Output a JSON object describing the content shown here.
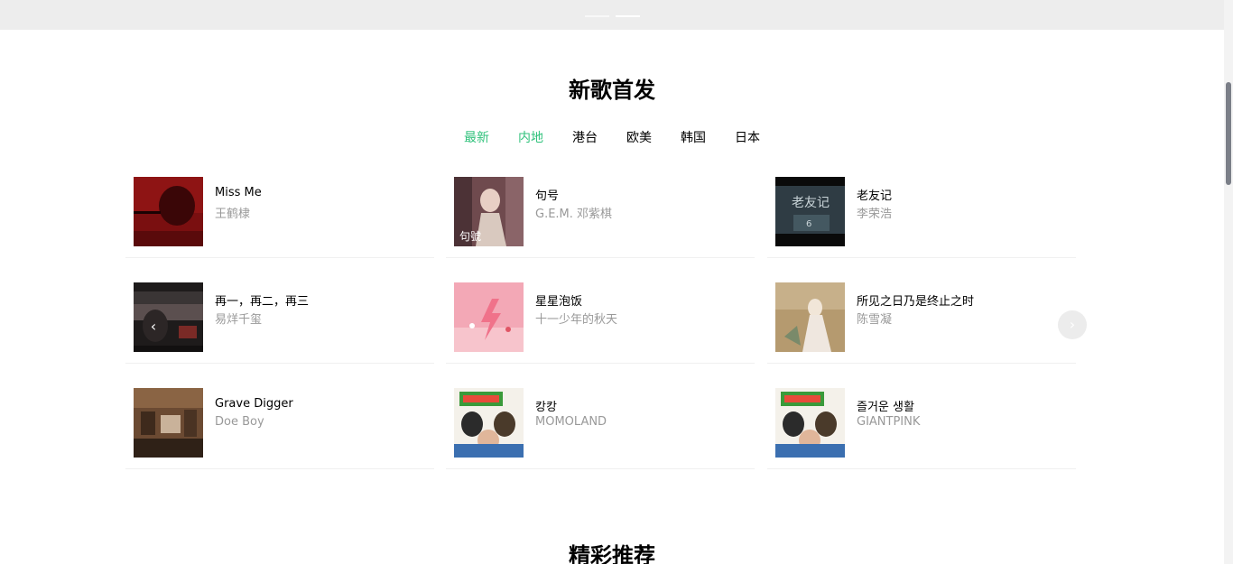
{
  "sections": {
    "new_songs_title": "新歌首发",
    "recommend_title": "精彩推荐"
  },
  "tabs": [
    {
      "label": "最新",
      "state": "active"
    },
    {
      "label": "内地",
      "state": "hover"
    },
    {
      "label": "港台",
      "state": "normal"
    },
    {
      "label": "欧美",
      "state": "normal"
    },
    {
      "label": "韩国",
      "state": "normal"
    },
    {
      "label": "日本",
      "state": "normal"
    }
  ],
  "songs": [
    {
      "name": "Miss Me",
      "artist": "王鹤棣"
    },
    {
      "name": "句号",
      "artist": "G.E.M. 邓紫棋"
    },
    {
      "name": "老友记",
      "artist": "李荣浩"
    },
    {
      "name": "再一，再二，再三",
      "artist": "易烊千玺"
    },
    {
      "name": "星星泡饭",
      "artist": "十一少年的秋天"
    },
    {
      "name": "所见之日乃是终止之时",
      "artist": "陈雪凝"
    },
    {
      "name": "Grave Digger",
      "artist": "Doe Boy"
    },
    {
      "name": "캉캉",
      "artist": "MOMOLAND"
    },
    {
      "name": "즐거운 생활",
      "artist": "GIANTPINK"
    }
  ],
  "controls": {
    "prev_arrow": "‹",
    "next_arrow": "›"
  },
  "colors": {
    "accent": "#31c27c",
    "artist_text": "#999999",
    "top_band": "#ededed",
    "scroll_thumb": "#7b7f88"
  },
  "icons": {
    "prev": "chevron-left-icon",
    "next": "chevron-right-icon"
  }
}
